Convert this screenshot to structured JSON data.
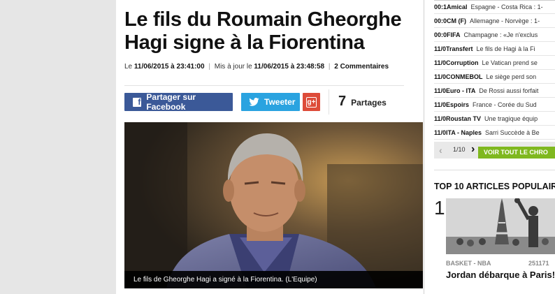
{
  "article": {
    "title": "Le fils du Roumain Gheorghe Hagi signe à la Fiorentina",
    "meta": {
      "prefix": "Le",
      "published": "11/06/2015 à 23:41:00",
      "separator": "|",
      "updated_label": "Mis à jour le",
      "updated": "11/06/2015 à 23:48:58",
      "comments": "2 Commentaires"
    },
    "share": {
      "facebook_label": "Partager sur Facebook",
      "twitter_label": "Tweeter",
      "gplus_label": "g+",
      "count": "7",
      "count_label": "Partages"
    },
    "photo": {
      "caption": "Le fils de Gheorghe Hagi a signé à la Fiorentina. (L'Equipe)"
    }
  },
  "sidebar": {
    "briefs": [
      {
        "time": "00:1",
        "category": "Amical",
        "text": "Espagne - Costa Rica : 1-"
      },
      {
        "time": "00:0",
        "category": "CM (F)",
        "text": "Allemagne - Norvège : 1-"
      },
      {
        "time": "00:0",
        "category": "FIFA",
        "text": "Champagne : «Je n'exclus"
      },
      {
        "time": "11/0",
        "category": "Transfert",
        "text": "Le fils de Hagi à la Fi"
      },
      {
        "time": "11/0",
        "category": "Corruption",
        "text": "Le Vatican prend se"
      },
      {
        "time": "11/0",
        "category": "CONMEBOL",
        "text": "Le siège perd son"
      },
      {
        "time": "11/0",
        "category": "Euro - ITA",
        "text": "De Rossi aussi forfait"
      },
      {
        "time": "11/0",
        "category": "Espoirs",
        "text": "France - Corée du Sud"
      },
      {
        "time": "11/0",
        "category": "Roustan TV",
        "text": "Une tragique équip"
      },
      {
        "time": "11/0",
        "category": "ITA - Naples",
        "text": "Sarri Succède à Be"
      }
    ],
    "pager": {
      "page": "1/10",
      "see_all": "VOIR TOUT LE CHRO"
    },
    "top10": {
      "title": "TOP 10 ARTICLES POPULAIR",
      "rank": "1",
      "category": "BASKET - NBA",
      "count": "251171",
      "headline": "Jordan débarque à Paris!"
    }
  },
  "colors": {
    "facebook": "#3b5998",
    "twitter": "#2aa3e0",
    "gplus": "#dd4b39",
    "accent_green": "#7fb81f"
  },
  "icons": [
    "facebook-icon",
    "twitter-icon",
    "gplus-icon",
    "chevron-left-icon",
    "chevron-right-icon"
  ]
}
